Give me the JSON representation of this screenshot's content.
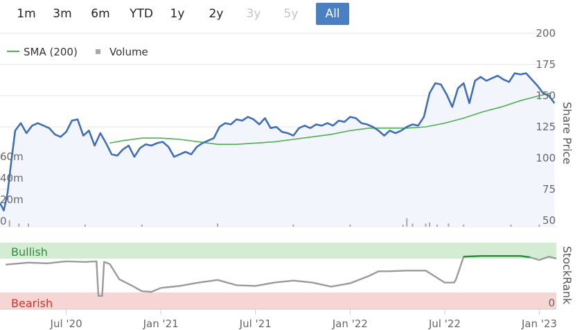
{
  "range_selector": {
    "buttons": [
      {
        "label": "1m",
        "state": "normal"
      },
      {
        "label": "3m",
        "state": "normal"
      },
      {
        "label": "6m",
        "state": "normal"
      },
      {
        "label": "YTD",
        "state": "normal"
      },
      {
        "label": "1y",
        "state": "normal"
      },
      {
        "label": "2y",
        "state": "normal"
      },
      {
        "label": "3y",
        "state": "disabled"
      },
      {
        "label": "5y",
        "state": "disabled"
      },
      {
        "label": "All",
        "state": "active"
      }
    ]
  },
  "legend": {
    "sma_label": "SMA (200)",
    "volume_label": "Volume"
  },
  "colors": {
    "price": "#3e6fb6",
    "price_fill": "#f2f5fb",
    "sma": "#4caf50",
    "volume": "#a8a8a8",
    "stockrank": "#9a9a9a",
    "stockrank_bullish_line": "#2e8b3a",
    "bullish_zone": "#d4ecd4",
    "bearish_zone": "#f6d5d5",
    "bullish_text": "#2e8b3a",
    "bearish_text": "#c0392b",
    "grid": "#e6e6e6"
  },
  "chart_data": {
    "type": "line",
    "x_ticks": [
      "Jul '20",
      "Jan '21",
      "Jul '21",
      "Jan '22",
      "Jul '22",
      "Jan '23"
    ],
    "x_tick_values": [
      2020.5,
      2021.0,
      2021.5,
      2022.0,
      2022.5,
      2023.0
    ],
    "xlim": [
      2020.15,
      2023.09
    ],
    "price_axis": {
      "title": "Share Price",
      "ticks": [
        "200",
        "175",
        "150",
        "125",
        "100",
        "75",
        "50"
      ],
      "tick_values": [
        200,
        175,
        150,
        125,
        100,
        75,
        50
      ],
      "ylim": [
        50,
        200
      ]
    },
    "volume_axis": {
      "ticks": [
        "0",
        "20m",
        "40m",
        "60m"
      ],
      "tick_values": [
        0,
        20,
        40,
        60
      ],
      "ylim": [
        0,
        180
      ]
    },
    "stockrank_axis": {
      "title": "StockRank",
      "ticks": [
        "0"
      ],
      "tick_values": [
        0
      ],
      "ylim": [
        0,
        100
      ],
      "zones": {
        "bullish": "Bullish",
        "bearish": "Bearish"
      },
      "bullish_threshold": 80
    },
    "series": [
      {
        "name": "Share Price",
        "kind": "price",
        "x": [
          2020.15,
          2020.17,
          2020.19,
          2020.21,
          2020.23,
          2020.26,
          2020.29,
          2020.32,
          2020.35,
          2020.38,
          2020.41,
          2020.44,
          2020.47,
          2020.5,
          2020.53,
          2020.56,
          2020.59,
          2020.62,
          2020.65,
          2020.68,
          2020.71,
          2020.74,
          2020.77,
          2020.8,
          2020.83,
          2020.86,
          2020.89,
          2020.92,
          2020.95,
          2020.98,
          2021.01,
          2021.04,
          2021.07,
          2021.1,
          2021.13,
          2021.16,
          2021.19,
          2021.22,
          2021.25,
          2021.28,
          2021.31,
          2021.34,
          2021.37,
          2021.4,
          2021.43,
          2021.46,
          2021.49,
          2021.52,
          2021.55,
          2021.58,
          2021.61,
          2021.64,
          2021.67,
          2021.7,
          2021.73,
          2021.76,
          2021.79,
          2021.82,
          2021.85,
          2021.88,
          2021.91,
          2021.94,
          2021.97,
          2022.0,
          2022.03,
          2022.06,
          2022.09,
          2022.12,
          2022.15,
          2022.18,
          2022.21,
          2022.24,
          2022.27,
          2022.3,
          2022.33,
          2022.36,
          2022.39,
          2022.42,
          2022.45,
          2022.48,
          2022.51,
          2022.54,
          2022.57,
          2022.6,
          2022.63,
          2022.66,
          2022.69,
          2022.72,
          2022.75,
          2022.78,
          2022.81,
          2022.84,
          2022.87,
          2022.9,
          2022.93,
          2022.96,
          2022.99,
          2023.02,
          2023.05,
          2023.08
        ],
        "y": [
          64,
          58,
          72,
          98,
          122,
          128,
          120,
          126,
          128,
          126,
          124,
          119,
          117,
          121,
          130,
          131,
          118,
          122,
          110,
          120,
          112,
          103,
          102,
          107,
          110,
          101,
          108,
          111,
          110,
          112,
          113,
          109,
          101,
          103,
          105,
          103,
          109,
          112,
          114,
          116,
          125,
          128,
          127,
          131,
          130,
          133,
          131,
          127,
          132,
          124,
          125,
          121,
          120,
          118,
          124,
          126,
          124,
          127,
          126,
          128,
          126,
          130,
          129,
          133,
          132,
          128,
          127,
          125,
          122,
          118,
          122,
          120,
          122,
          125,
          127,
          126,
          133,
          152,
          160,
          159,
          151,
          141,
          156,
          160,
          144,
          162,
          165,
          162,
          164,
          166,
          163,
          161,
          168,
          167,
          168,
          163,
          158,
          152,
          150,
          144
        ]
      },
      {
        "name": "SMA (200)",
        "kind": "sma",
        "x": [
          2020.73,
          2020.8,
          2020.9,
          2021.0,
          2021.1,
          2021.2,
          2021.3,
          2021.4,
          2021.5,
          2021.6,
          2021.7,
          2021.8,
          2021.9,
          2022.0,
          2022.1,
          2022.2,
          2022.3,
          2022.4,
          2022.5,
          2022.6,
          2022.7,
          2022.8,
          2022.9,
          2023.0,
          2023.06
        ],
        "y": [
          112,
          114,
          116,
          116,
          115,
          113,
          111,
          111,
          112,
          113,
          115,
          117,
          119,
          122,
          124,
          124,
          124,
          125,
          128,
          132,
          137,
          141,
          146,
          150,
          152
        ]
      },
      {
        "name": "Volume",
        "kind": "volume",
        "x": [
          2020.2,
          2020.25,
          2020.3,
          2020.6,
          2020.9,
          2021.3,
          2021.7,
          2022.0,
          2022.28,
          2022.3,
          2022.33,
          2022.4,
          2022.42,
          2022.46,
          2022.52,
          2022.6,
          2022.85,
          2023.0
        ],
        "y": [
          6,
          3,
          3,
          2,
          2,
          3,
          2,
          2,
          2,
          8,
          3,
          3,
          4,
          2,
          3,
          2,
          2,
          2
        ]
      },
      {
        "name": "StockRank",
        "kind": "stockrank",
        "x": [
          2020.18,
          2020.22,
          2020.3,
          2020.4,
          2020.5,
          2020.6,
          2020.66,
          2020.67,
          2020.69,
          2020.7,
          2020.73,
          2020.78,
          2020.85,
          2020.9,
          2020.95,
          2021.0,
          2021.1,
          2021.2,
          2021.3,
          2021.4,
          2021.5,
          2021.6,
          2021.7,
          2021.8,
          2021.9,
          2022.0,
          2022.1,
          2022.15,
          2022.2,
          2022.3,
          2022.4,
          2022.45,
          2022.5,
          2022.55,
          2022.56,
          2022.6,
          2022.7,
          2022.8,
          2022.9,
          2022.95,
          2023.0,
          2023.05,
          2023.09
        ],
        "y": [
          67,
          68,
          70,
          69,
          72,
          71,
          72,
          20,
          20,
          71,
          68,
          45,
          35,
          27,
          26,
          32,
          35,
          40,
          44,
          36,
          35,
          40,
          43,
          40,
          34,
          39,
          50,
          57,
          57,
          58,
          58,
          49,
          40,
          40,
          45,
          79,
          80,
          80,
          80,
          78,
          74,
          79,
          76
        ]
      }
    ]
  }
}
